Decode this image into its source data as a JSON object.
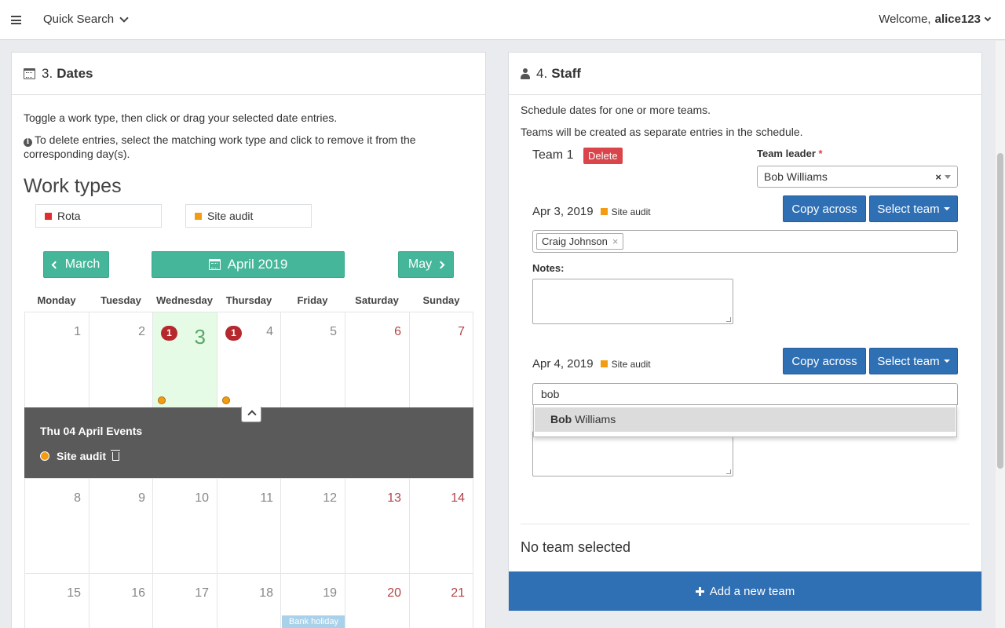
{
  "header": {
    "quick_search": "Quick Search",
    "welcome": "Welcome,",
    "username": "alice123"
  },
  "dates_panel": {
    "step": "3.",
    "title": "Dates",
    "instruction": "Toggle a work type, then click or drag your selected date entries.",
    "delete_info": "To delete entries, select the matching work type and click to remove it from the corresponding day(s).",
    "work_types_heading": "Work types",
    "work_types": [
      {
        "label": "Rota",
        "color": "#e02d2d"
      },
      {
        "label": "Site audit",
        "color": "#f39c12"
      }
    ],
    "nav": {
      "prev": "March",
      "current": "April 2019",
      "next": "May"
    },
    "weekdays": [
      "Monday",
      "Tuesday",
      "Wednesday",
      "Thursday",
      "Friday",
      "Saturday",
      "Sunday"
    ],
    "week1": [
      "1",
      "2",
      "3",
      "4",
      "5",
      "6",
      "7"
    ],
    "week2": [
      "8",
      "9",
      "10",
      "11",
      "12",
      "13",
      "14"
    ],
    "week3": [
      "15",
      "16",
      "17",
      "18",
      "19",
      "20",
      "21"
    ],
    "badges": {
      "wed": "1",
      "thu": "1"
    },
    "events": {
      "title": "Thu 04 April Events",
      "item": "Site audit"
    },
    "bank_holiday": "Bank holiday"
  },
  "staff_panel": {
    "step": "4.",
    "title": "Staff",
    "text1": "Schedule dates for one or more teams.",
    "text2": "Teams will be created as separate entries in the schedule.",
    "team_name": "Team 1",
    "delete_label": "Delete",
    "team_leader_label": "Team leader",
    "required_mark": "*",
    "team_leader_value": "Bob Williams",
    "clear_mark": "×",
    "entries": [
      {
        "date": "Apr 3, 2019",
        "type": "Site audit",
        "chip": "Craig Johnson",
        "chip_remove": "×"
      },
      {
        "date": "Apr 4, 2019",
        "type": "Site audit"
      }
    ],
    "copy_across": "Copy across",
    "select_team": "Select team",
    "notes_label": "Notes:",
    "search_value": "bob",
    "dropdown_match": "Bob",
    "dropdown_rest": " Williams",
    "no_team": "No team selected",
    "add_team": "Add a new team"
  }
}
